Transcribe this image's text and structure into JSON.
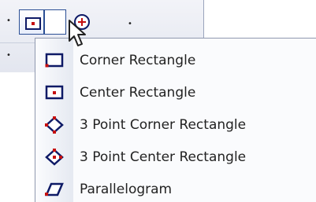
{
  "toolbar": {
    "active_tool_icon": "center-rectangle-icon",
    "next_tool_icon": "circle-icon",
    "colors": {
      "outline": "#0e1a66",
      "accent_red": "#c61010",
      "button_border": "#2b4f95"
    }
  },
  "menu": {
    "items": [
      {
        "label": "Corner Rectangle",
        "icon": "corner-rectangle-icon"
      },
      {
        "label": "Center Rectangle",
        "icon": "center-rectangle-icon"
      },
      {
        "label": "3 Point Corner Rectangle",
        "icon": "3-point-corner-rectangle-icon"
      },
      {
        "label": "3 Point Center Rectangle",
        "icon": "3-point-center-rectangle-icon"
      },
      {
        "label": "Parallelogram",
        "icon": "parallelogram-icon"
      }
    ]
  }
}
